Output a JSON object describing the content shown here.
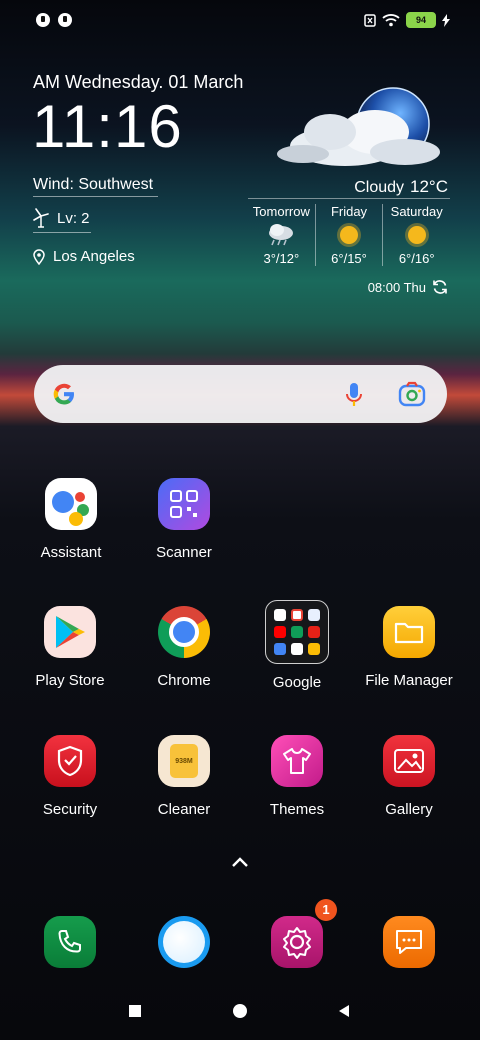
{
  "status_bar": {
    "battery_level": "94",
    "left_icons": [
      "app-notification-icon",
      "app-notification-icon"
    ],
    "right_icons": [
      "sim-icon",
      "wifi-icon",
      "battery-icon",
      "charging-icon"
    ]
  },
  "weather": {
    "date_line": "AM Wednesday. 01 March",
    "time": "11:16",
    "wind": "Wind: Southwest",
    "level": "Lv: 2",
    "location": "Los Angeles",
    "condition": "Cloudy",
    "temperature": "12°C",
    "forecast": [
      {
        "day": "Tomorrow",
        "range": "3°/12°",
        "icon": "rain-cloud-icon"
      },
      {
        "day": "Friday",
        "range": "6°/15°",
        "icon": "sun-icon"
      },
      {
        "day": "Saturday",
        "range": "6°/16°",
        "icon": "sun-icon"
      }
    ],
    "updated": "08:00 Thu"
  },
  "search": {
    "icons": [
      "google-g-icon",
      "mic-icon",
      "lens-icon"
    ]
  },
  "apps": {
    "assistant": "Assistant",
    "scanner": "Scanner",
    "play_store": "Play Store",
    "chrome": "Chrome",
    "google": "Google",
    "file_manager": "File Manager",
    "security": "Security",
    "cleaner": "Cleaner",
    "cleaner_icon_text": "938M",
    "themes": "Themes",
    "gallery": "Gallery"
  },
  "dock": {
    "icons": [
      "phone-icon",
      "browser-icon",
      "settings-icon",
      "messages-icon"
    ],
    "settings_badge": "1"
  },
  "nav_bar": {
    "icons": [
      "recents-icon",
      "home-icon",
      "back-icon"
    ]
  },
  "colors": {
    "accent_badge": "#f0541e",
    "battery": "#8bd44a"
  }
}
